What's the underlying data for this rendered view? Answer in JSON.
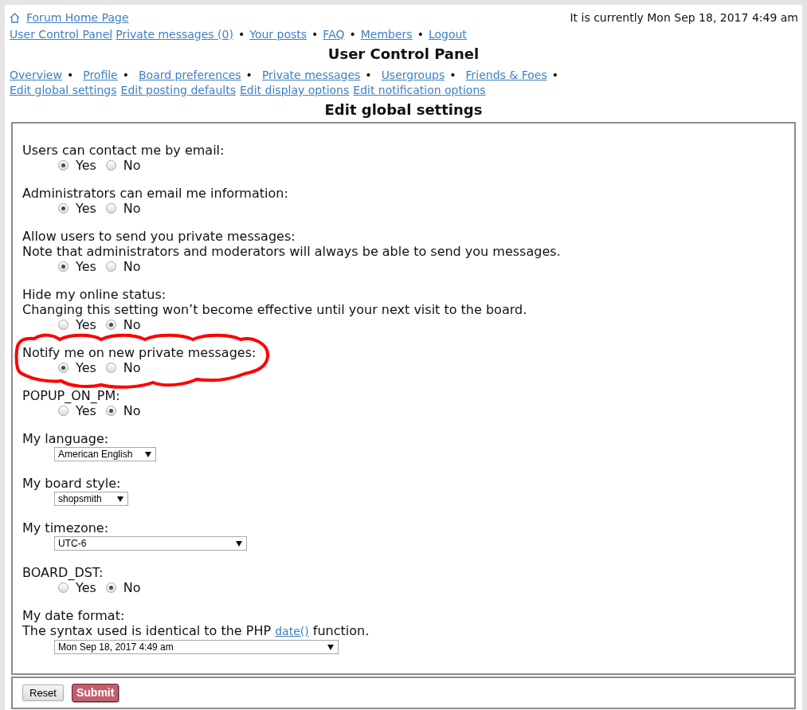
{
  "header": {
    "home_link": "Forum Home Page",
    "current_time": "It is currently Mon Sep 18, 2017 4:49 am"
  },
  "top_nav": [
    {
      "kind": "link",
      "label": "User Control Panel"
    },
    {
      "kind": "link",
      "label": "Private messages (0)"
    },
    {
      "kind": "separator",
      "label": "•"
    },
    {
      "kind": "link",
      "label": "Your posts"
    },
    {
      "kind": "separator",
      "label": "•"
    },
    {
      "kind": "link",
      "label": "FAQ"
    },
    {
      "kind": "separator",
      "label": "•"
    },
    {
      "kind": "link",
      "label": "Members"
    },
    {
      "kind": "separator",
      "label": "•"
    },
    {
      "kind": "link",
      "label": "Logout"
    }
  ],
  "title": "User Control Panel",
  "tabs": [
    {
      "kind": "link",
      "label": "Overview"
    },
    {
      "kind": "separator",
      "label": "•"
    },
    {
      "kind": "link",
      "label": "Profile"
    },
    {
      "kind": "separator",
      "label": "•"
    },
    {
      "kind": "link",
      "label": "Board preferences"
    },
    {
      "kind": "separator",
      "label": "•"
    },
    {
      "kind": "link",
      "label": "Private messages"
    },
    {
      "kind": "separator",
      "label": "•"
    },
    {
      "kind": "link",
      "label": "Usergroups"
    },
    {
      "kind": "separator",
      "label": "•"
    },
    {
      "kind": "link",
      "label": "Friends & Foes"
    },
    {
      "kind": "separator",
      "label": "•"
    }
  ],
  "subtabs": [
    "Edit global settings",
    "Edit posting defaults",
    "Edit display options",
    "Edit notification options"
  ],
  "section_title": "Edit global settings",
  "settings": [
    {
      "kind": "radio",
      "label": "Users can contact me by email:",
      "circled": false,
      "options": [
        {
          "label": "Yes",
          "selected": true
        },
        {
          "label": "No",
          "selected": false
        }
      ]
    },
    {
      "kind": "radio",
      "label": "Administrators can email me information:",
      "circled": false,
      "options": [
        {
          "label": "Yes",
          "selected": true
        },
        {
          "label": "No",
          "selected": false
        }
      ]
    },
    {
      "kind": "radio",
      "label": "Allow users to send you private messages:",
      "note": [
        {
          "kind": "text",
          "text": "Note that administrators and moderators will always be able to send you messages."
        }
      ],
      "circled": false,
      "options": [
        {
          "label": "Yes",
          "selected": true
        },
        {
          "label": "No",
          "selected": false
        }
      ]
    },
    {
      "kind": "radio",
      "label": "Hide my online status:",
      "note": [
        {
          "kind": "text",
          "text": "Changing this setting won’t become effective until your next visit to the board."
        }
      ],
      "circled": false,
      "options": [
        {
          "label": "Yes",
          "selected": false
        },
        {
          "label": "No",
          "selected": true
        }
      ]
    },
    {
      "kind": "radio",
      "label": "Notify me on new private messages:",
      "circled": true,
      "options": [
        {
          "label": "Yes",
          "selected": true
        },
        {
          "label": "No",
          "selected": false
        }
      ]
    },
    {
      "kind": "radio",
      "label": "POPUP_ON_PM:",
      "circled": false,
      "options": [
        {
          "label": "Yes",
          "selected": false
        },
        {
          "label": "No",
          "selected": true
        }
      ]
    },
    {
      "kind": "select",
      "label": "My language:",
      "circled": false,
      "value": "American English"
    },
    {
      "kind": "select",
      "label": "My board style:",
      "circled": false,
      "value": "shopsmith"
    },
    {
      "kind": "select",
      "label": "My timezone:",
      "circled": false,
      "value": "UTC-6"
    },
    {
      "kind": "radio",
      "label": "BOARD_DST:",
      "circled": false,
      "options": [
        {
          "label": "Yes",
          "selected": false
        },
        {
          "label": "No",
          "selected": true
        }
      ]
    },
    {
      "kind": "select",
      "label": "My date format:",
      "note": [
        {
          "kind": "text",
          "text": "The syntax used is identical to the PHP "
        },
        {
          "kind": "link",
          "text": "date()"
        },
        {
          "kind": "text",
          "text": " function."
        }
      ],
      "circled": false,
      "value": "Mon Sep 18, 2017 4:49 am"
    }
  ],
  "buttons": [
    {
      "kind": "reset",
      "label": "Reset"
    },
    {
      "kind": "submit",
      "label": "Submit"
    }
  ]
}
